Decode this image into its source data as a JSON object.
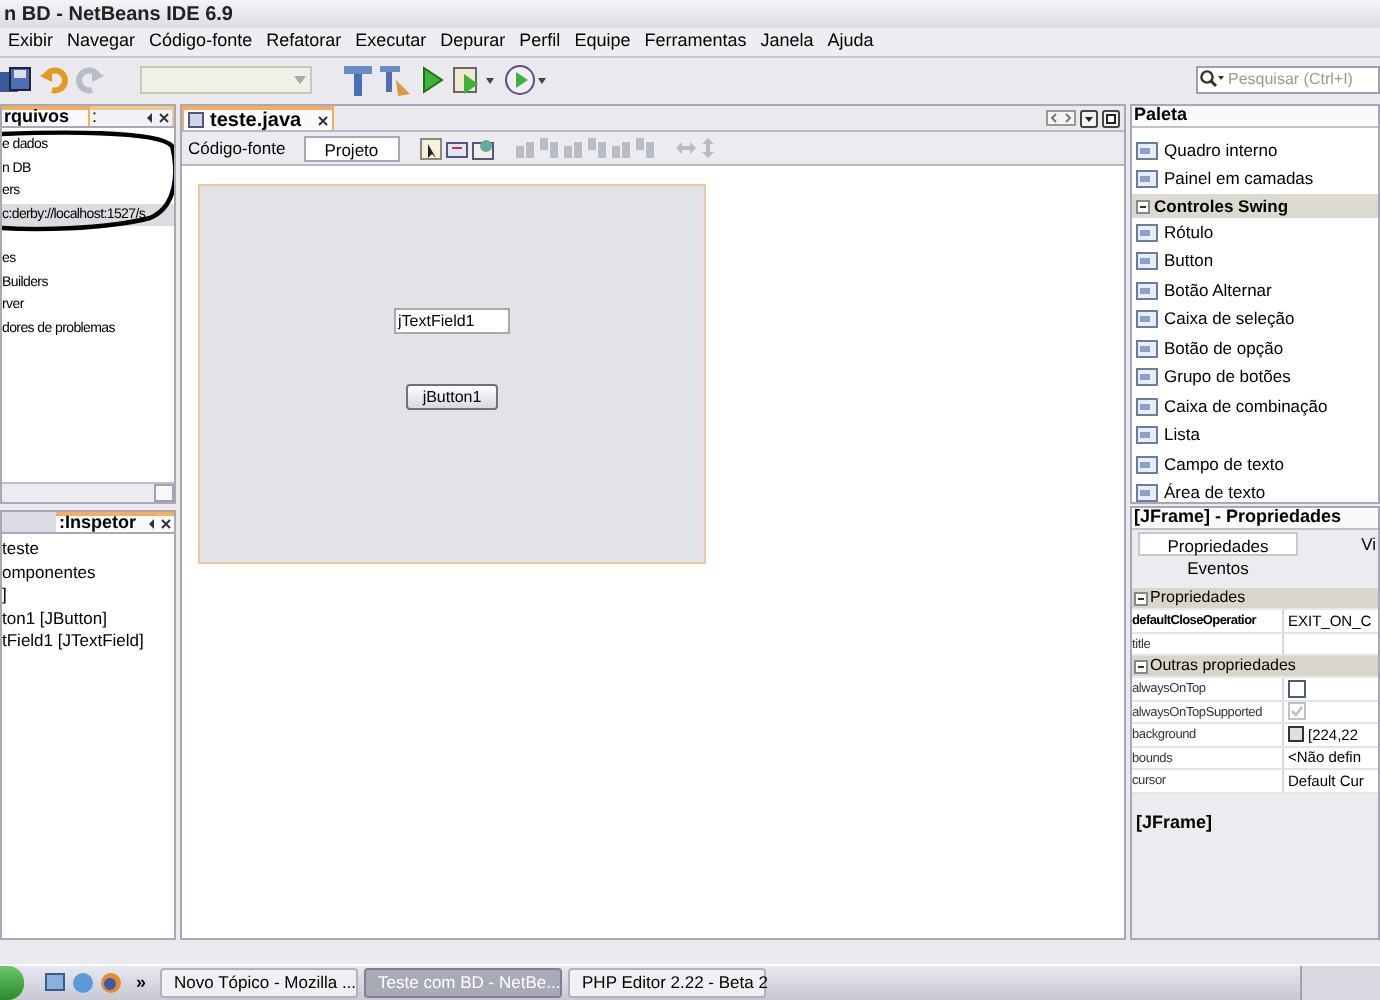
{
  "window": {
    "title": "n BD - NetBeans IDE 6.9"
  },
  "menu": [
    "Exibir",
    "Navegar",
    "Código-fonte",
    "Refatorar",
    "Executar",
    "Depurar",
    "Perfil",
    "Equipe",
    "Ferramentas",
    "Janela",
    "Ajuda"
  ],
  "toolbar": {
    "search": {
      "placeholder": "Pesquisar (Ctrl+I)"
    }
  },
  "files_panel": {
    "tabs": [
      {
        "label": "rquivos",
        "selected": true
      },
      {
        "label": ":",
        "selected": false
      }
    ],
    "items": [
      {
        "label": "e dados",
        "selected": false
      },
      {
        "label": "n DB",
        "selected": false
      },
      {
        "label": "ers",
        "selected": false
      },
      {
        "label": "c:derby://localhost:1527/s",
        "selected": true
      },
      {
        "label": "es",
        "selected": false
      },
      {
        "label": "Builders",
        "selected": false
      },
      {
        "label": "rver",
        "selected": false
      },
      {
        "label": "dores de problemas",
        "selected": false
      }
    ]
  },
  "inspector_panel": {
    "title": ":Inspetor",
    "items": [
      "teste",
      "omponentes",
      "]",
      "ton1 [JButton]",
      "tField1 [JTextField]"
    ]
  },
  "editor": {
    "tab": "teste.java",
    "views": [
      {
        "label": "Código-fonte",
        "selected": false
      },
      {
        "label": "Projeto",
        "selected": true
      }
    ],
    "form": [
      {
        "kind": "textfield",
        "text": "jTextField1"
      },
      {
        "kind": "button",
        "text": "jButton1"
      }
    ]
  },
  "palette": {
    "title": "Paleta",
    "items": [
      {
        "kind": "item",
        "label": "Quadro interno"
      },
      {
        "kind": "item",
        "label": "Painel em camadas"
      },
      {
        "kind": "category",
        "label": "Controles Swing",
        "expanded": true
      },
      {
        "kind": "item",
        "label": "Rótulo"
      },
      {
        "kind": "item",
        "label": "Button"
      },
      {
        "kind": "item",
        "label": "Botão Alternar"
      },
      {
        "kind": "item",
        "label": "Caixa de seleção"
      },
      {
        "kind": "item",
        "label": "Botão de opção"
      },
      {
        "kind": "item",
        "label": "Grupo de botões"
      },
      {
        "kind": "item",
        "label": "Caixa de combinação"
      },
      {
        "kind": "item",
        "label": "Lista"
      },
      {
        "kind": "item",
        "label": "Campo de texto"
      },
      {
        "kind": "item",
        "label": "Área de texto"
      }
    ]
  },
  "properties": {
    "title": "[JFrame] - Propriedades",
    "tabs": [
      {
        "label": "Propriedades",
        "selected": true
      },
      {
        "label": "Vi",
        "selected": false
      },
      {
        "label": "Eventos",
        "selected": false
      }
    ],
    "sections": [
      {
        "label": "Propriedades",
        "expanded": true,
        "rows": [
          {
            "name": "defaultCloseOperatior",
            "bold": true,
            "kind": "text",
            "value": "EXIT_ON_C"
          },
          {
            "name": "title",
            "bold": false,
            "kind": "text"
          }
        ]
      },
      {
        "label": "Outras propriedades",
        "expanded": true,
        "rows": [
          {
            "name": "alwaysOnTop",
            "bold": false,
            "kind": "checkbox",
            "checked": false,
            "disabled": false
          },
          {
            "name": "alwaysOnTopSupported",
            "bold": false,
            "kind": "checkbox",
            "checked": true,
            "disabled": true
          },
          {
            "name": "background",
            "bold": false,
            "kind": "color",
            "value": "[224,22"
          },
          {
            "name": "bounds",
            "bold": false,
            "kind": "text",
            "value": "<Não defin"
          },
          {
            "name": "cursor",
            "bold": false,
            "kind": "text",
            "value": "Default Cur"
          }
        ]
      }
    ],
    "footer": "[JFrame]"
  },
  "taskbar": {
    "more": "»",
    "tasks": [
      {
        "label": "Novo Tópico - Mozilla ...",
        "selected": false
      },
      {
        "label": "Teste com BD - NetBe...",
        "selected": true
      },
      {
        "label": "PHP Editor 2.22 - Beta 2",
        "selected": false
      }
    ]
  }
}
